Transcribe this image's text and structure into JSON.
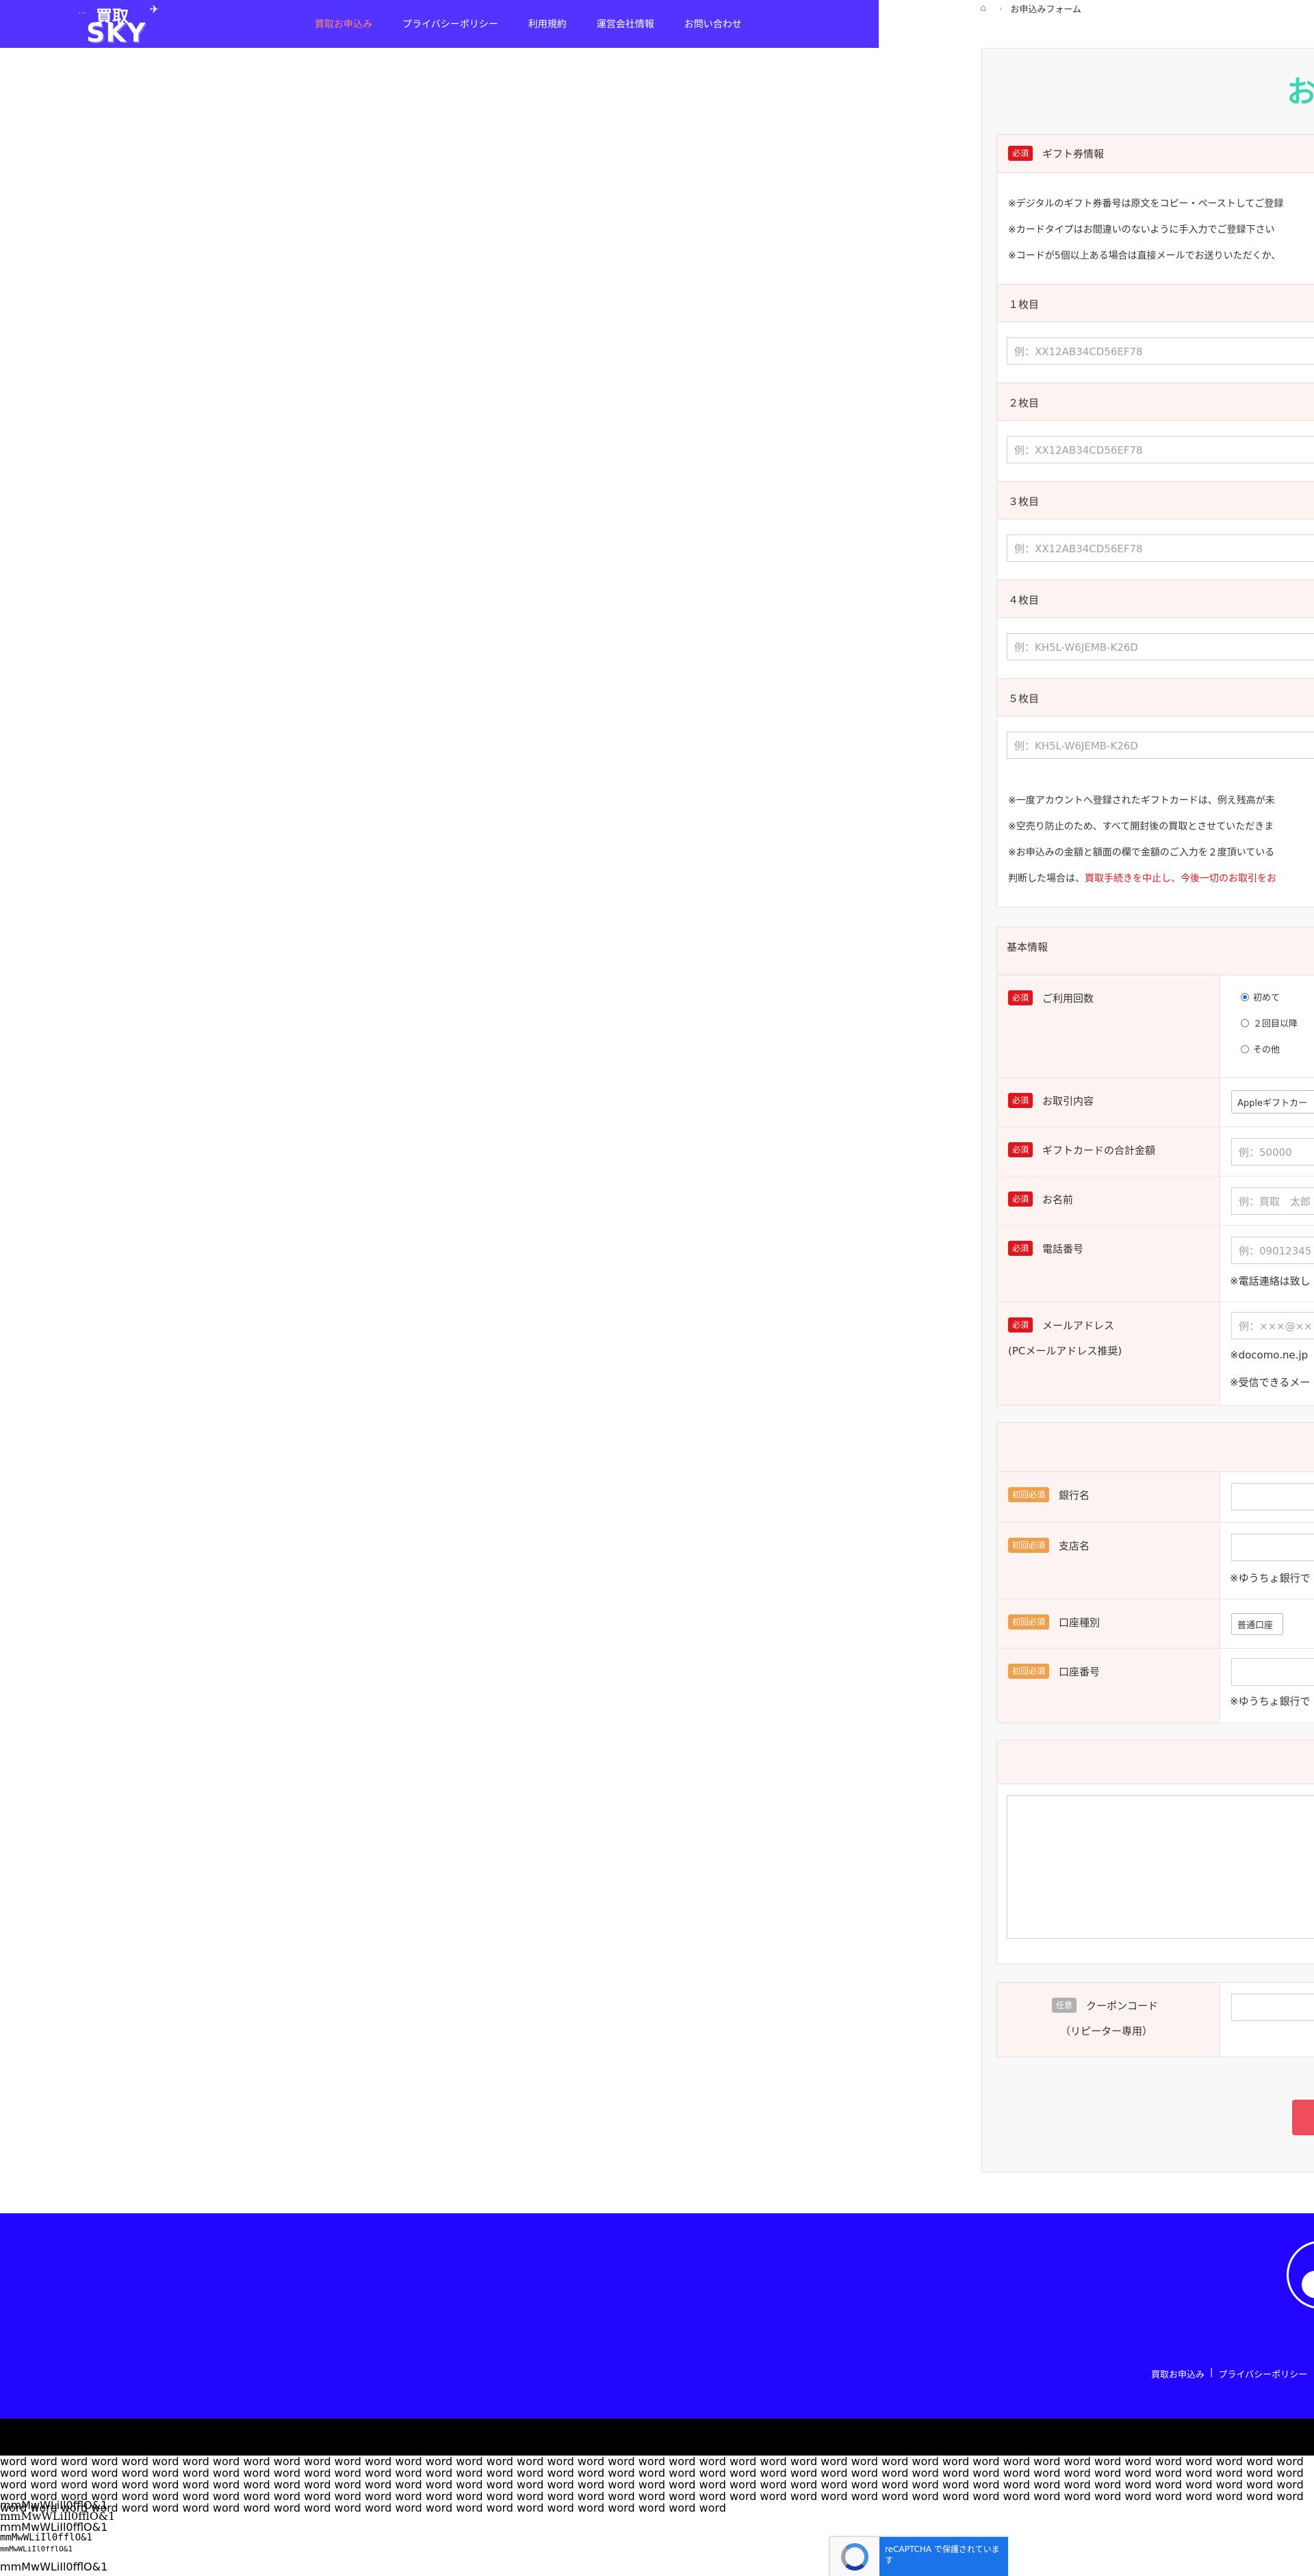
{
  "header": {
    "logo_top": "買取",
    "logo_brand": "SKY",
    "nav": [
      {
        "label": "買取お申込み",
        "active": true
      },
      {
        "label": "プライバシーポリシー",
        "active": false
      },
      {
        "label": "利用規約",
        "active": false
      },
      {
        "label": "運営会社情報",
        "active": false
      },
      {
        "label": "お問い合わせ",
        "active": false
      }
    ]
  },
  "breadcrumb": {
    "current": "お申込みフォーム"
  },
  "form": {
    "title": "お",
    "gift": {
      "badge": "必須",
      "title": "ギフト券情報",
      "notes": [
        "※デジタルのギフト券番号は原文をコピー・ペーストしてご登録",
        "※カードタイプはお間違いのないように手入力でご登録下さい",
        "※コードが5個以上ある場合は直接メールでお送りいただくか、"
      ],
      "cards": [
        {
          "label": "１枚目",
          "placeholder": "例：XX12AB34CD56EF78"
        },
        {
          "label": "２枚目",
          "placeholder": "例：XX12AB34CD56EF78"
        },
        {
          "label": "３枚目",
          "placeholder": "例：XX12AB34CD56EF78"
        },
        {
          "label": "４枚目",
          "placeholder": "例：KH5L-W6JEMB-K26D"
        },
        {
          "label": "５枚目",
          "placeholder": "例：KH5L-W6JEMB-K26D"
        }
      ],
      "warnings": [
        "※一度アカウントへ登録されたギフトカードは、例え残高が未",
        "※空売り防止のため、すべて開封後の買取とさせていただきま",
        "※お申込みの金額と額面の欄で金額のご入力を２度頂いている"
      ],
      "warning_last_prefix": "判断した場合は、",
      "warning_last_red": "買取手続きを中止し、今後一切のお取引をお"
    },
    "basic": {
      "title": "基本情報",
      "usage": {
        "badge": "必須",
        "label": "ご利用回数",
        "options": [
          "初めて",
          "２回目以降",
          "その他"
        ]
      },
      "deal": {
        "badge": "必須",
        "label": "お取引内容",
        "selected": "Appleギフトカー"
      },
      "amount": {
        "badge": "必須",
        "label": "ギフトカードの合計金額",
        "placeholder": "例：50000"
      },
      "name": {
        "badge": "必須",
        "label": "お名前",
        "placeholder": "例：買取　太郎"
      },
      "phone": {
        "badge": "必須",
        "label": "電話番号",
        "placeholder": "例：09012345",
        "note": "※電話連絡は致し"
      },
      "email": {
        "badge": "必須",
        "label": "メールアドレス",
        "sublabel": "(PCメールアドレス推奨)",
        "placeholder": "例：×××@××",
        "note1": "※docomo.ne.jp",
        "note2": "※受信できるメー"
      }
    },
    "bank": {
      "bank_name": {
        "badge": "初回必須",
        "label": "銀行名"
      },
      "branch": {
        "badge": "初回必須",
        "label": "支店名",
        "note": "※ゆうちょ銀行で"
      },
      "account_type": {
        "badge": "初回必須",
        "label": "口座種別",
        "selected": "普通口座"
      },
      "account_no": {
        "badge": "初回必須",
        "label": "口座番号",
        "note": "※ゆうちょ銀行で"
      }
    },
    "coupon": {
      "badge": "任意",
      "label": "クーポンコード",
      "sublabel": "（リピーター専用）"
    }
  },
  "footer": {
    "links": [
      "買取お申込み",
      "|",
      "プライバシーポリシー"
    ]
  },
  "probe": {
    "words": "word word word word word word word word word word word word word word word word word word word word word word word word word word word word word word word word word word word word word word word word word word word word word word word word word word word word word word word word word word word word word word word word word word word word word word word word word word word word word word word word word word word word word word word word word word word word word word word word word word word word word word word word word word word word word word word word word word word word word word word word word word word word word word word word word word word word word word word word word word word word word word word word word word word word word word word word word word word word word word word word word word word word word word word word word word word word word word word word word word word word word word word word word word word word word word word word word word word word",
    "glyphs_1": "mmMwWLiIl0fflO&1",
    "glyphs_2": "mmMwWLiIl0fflO&1",
    "glyphs_3": "mmMwWLiIl0fflO&1",
    "glyphs_4": "mmMwWLiIl0fflO&1",
    "glyphs_5": "mmMwWLiIl0fflO&1",
    "glyphs_6": "mmMwWLiIl0fflO&1"
  },
  "recaptcha": {
    "text": "reCAPTCHA で保護されていま す"
  }
}
